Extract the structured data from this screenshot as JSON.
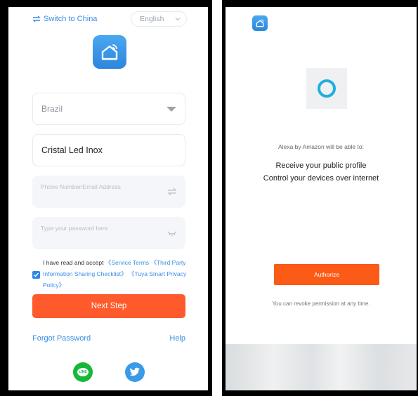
{
  "left_screen": {
    "switch_label": "Switch to China",
    "language": "English",
    "country": "Brazil",
    "name_value": "Cristal Led Inox",
    "phone_placeholder": "Phone Number/Email Address",
    "password_placeholder": "Type your password here",
    "agree_prefix": "I have read and accept",
    "service_terms": "《Service Terms",
    "third_party": "《Third Party Information Sharing Checklist》",
    "privacy_policy": "《Tuya Smart Privacy Policy》",
    "next_step": "Next Step",
    "forgot_password": "Forgot Password",
    "help": "Help",
    "line_glyph": "LINE",
    "icons": [
      "swap-icon",
      "chevron-down-icon",
      "home-wifi-icon",
      "dropdown-triangle-icon",
      "swap-vertical-icon",
      "eye-closed-icon",
      "checkbox-checked-icon",
      "line-icon",
      "twitter-icon"
    ]
  },
  "right_screen": {
    "able_to": "Alexa by Amazon will be able to:",
    "permission_1": "Receive your public profile",
    "permission_2": "Control your devices over internet",
    "authorize": "Authorize",
    "revoke": "You can revoke permission at any time.",
    "icons": [
      "home-wifi-icon",
      "alexa-icon"
    ]
  },
  "colors": {
    "accent_blue": "#3a8ee6",
    "next_step_orange": "#fe5a2b",
    "authorize_orange": "#fb5b17",
    "line_green": "#15b837",
    "twitter_blue": "#3a9ae6",
    "alexa_cyan": "#21b0dd"
  }
}
